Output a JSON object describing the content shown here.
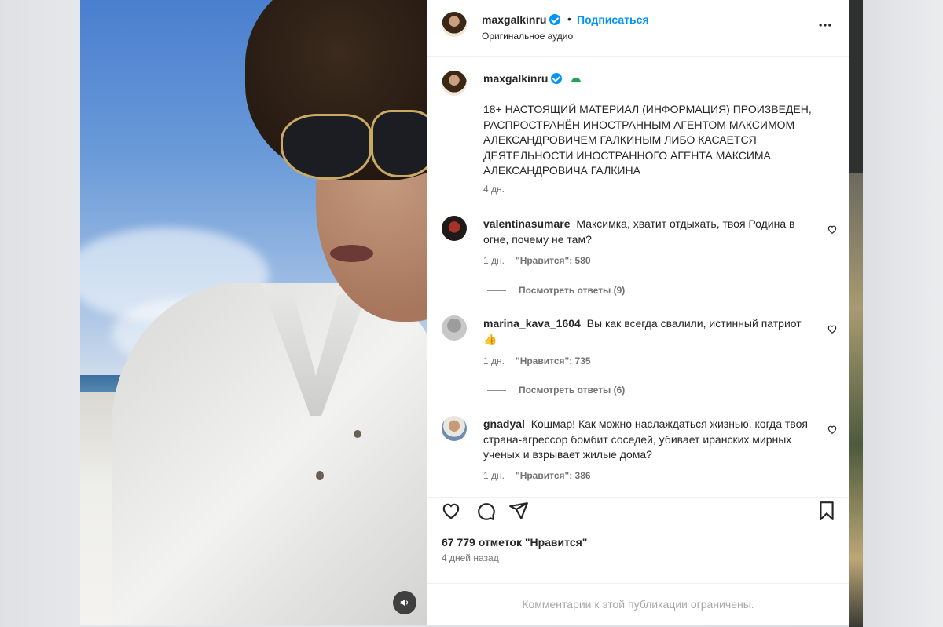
{
  "header": {
    "username": "maxgalkinru",
    "follow_label": "Подписаться",
    "separator": "•",
    "audio_label": "Оригинальное аудио",
    "more_icon": "more-horizontal-icon"
  },
  "caption": {
    "username": "maxgalkinru",
    "text": "18+ НАСТОЯЩИЙ МАТЕРИАЛ (ИНФОРМАЦИЯ) ПРОИЗВЕДЕН, РАСПРОСТРАНЁН ИНОСТРАННЫМ АГЕНТОМ МАКСИМОМ АЛЕКСАНДРОВИЧЕМ ГАЛКИНЫМ ЛИБО КАСАЕТСЯ ДЕЯТЕЛЬНОСТИ ИНОСТРАННОГО АГЕНТА МАКСИМА АЛЕКСАНДРОВИЧА ГАЛКИНА",
    "time": "4 дн."
  },
  "comments": [
    {
      "username": "valentinasumare",
      "text": "Максимка, хватит отдыхать, твоя Родина в огне, почему не там?",
      "time": "1 дн.",
      "likes": "\"Нравится\": 580",
      "replies": "Посмотреть ответы (9)"
    },
    {
      "username": "marina_kava_1604",
      "text": "Вы как всегда свалили, истинный патриот 👍",
      "time": "1 дн.",
      "likes": "\"Нравится\": 735",
      "replies": "Посмотреть ответы (6)"
    },
    {
      "username": "gnadyal",
      "text": "Кошмар! Как можно наслаждаться жизнью, когда твоя страна-агрессор бомбит соседей, убивает иранских мирных ученых и взрывает жилые дома?",
      "time": "1 дн.",
      "likes": "\"Нравится\": 386"
    }
  ],
  "actions": {
    "like_icon": "heart-icon",
    "comment_icon": "comment-icon",
    "share_icon": "send-icon",
    "save_icon": "bookmark-icon"
  },
  "likes_count": "67 779 отметок \"Нравится\"",
  "post_date": "4 дней назад",
  "comments_restricted": "Комментарии к этой публикации ограничены.",
  "video": {
    "mute_icon": "speaker-icon"
  },
  "colors": {
    "link_blue": "#0095f6",
    "text_primary": "#262626",
    "text_secondary": "#737373"
  }
}
